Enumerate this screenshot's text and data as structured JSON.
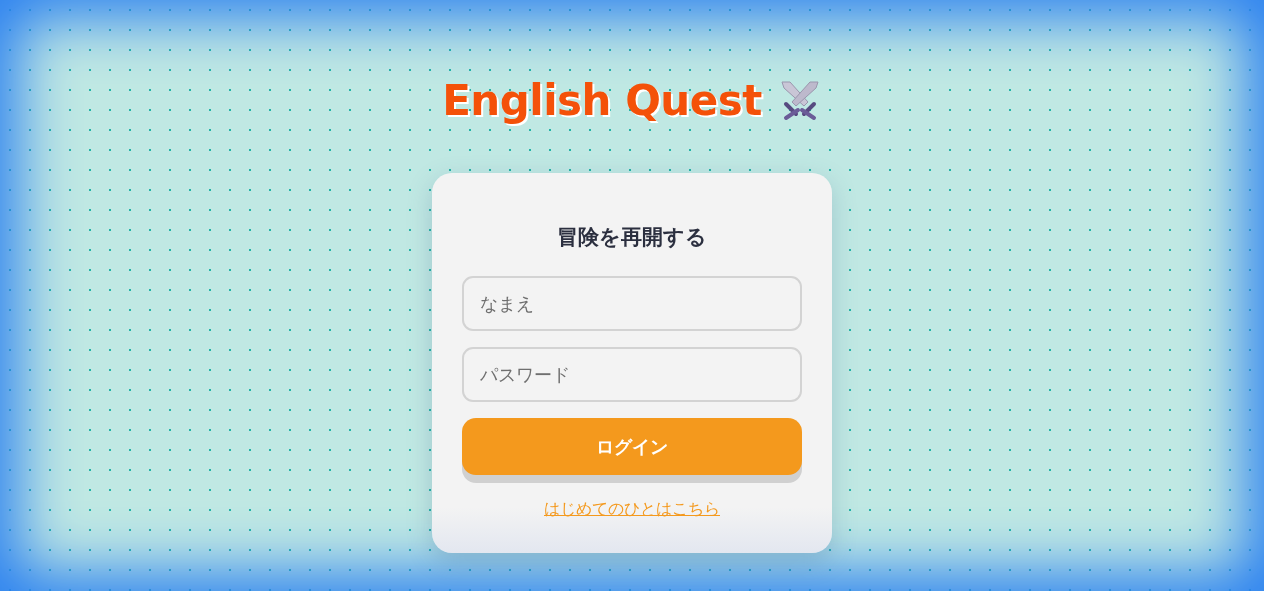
{
  "app_title": "English Quest",
  "login_card": {
    "heading": "冒険を再開する",
    "fields": [
      {
        "placeholder": "なまえ"
      },
      {
        "placeholder": "パスワード"
      }
    ],
    "submit_button": "ログイン",
    "signup_link": "はじめてのひとはこちら"
  }
}
